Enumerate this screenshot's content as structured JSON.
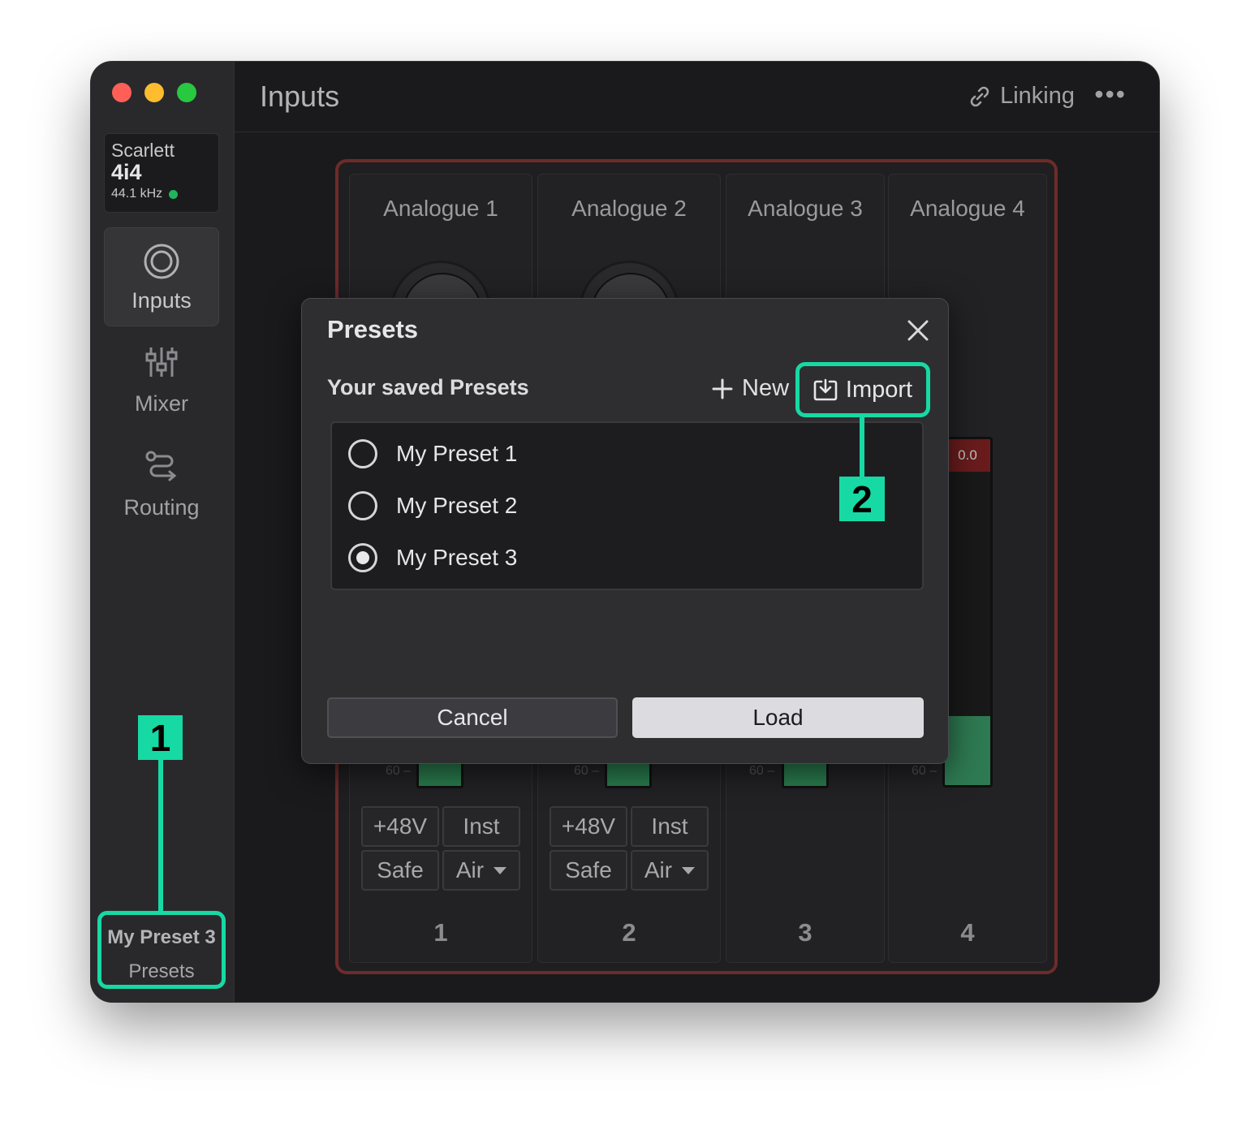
{
  "window": {
    "title": "Inputs"
  },
  "colors": {
    "accent": "#17d9a4",
    "traffic_red": "#ff5f57",
    "traffic_yellow": "#febc2e",
    "traffic_green": "#28c840",
    "status_led": "#22b35d"
  },
  "device": {
    "brand": "Scarlett",
    "model": "4i4",
    "sample_rate": "44.1 kHz"
  },
  "sidebar": {
    "items": [
      {
        "label": "Inputs",
        "icon": "inputs-icon",
        "active": true
      },
      {
        "label": "Mixer",
        "icon": "mixer-icon",
        "active": false
      },
      {
        "label": "Routing",
        "icon": "routing-icon",
        "active": false
      }
    ],
    "preset": {
      "name": "My Preset 3",
      "label": "Presets"
    }
  },
  "header": {
    "linking_label": "Linking",
    "more_label": "•••"
  },
  "channels": [
    {
      "title": "Analogue 1",
      "number": "1",
      "buttons": [
        "+48V",
        "Inst",
        "Safe",
        "Air"
      ],
      "scale_label": "60 –"
    },
    {
      "title": "Analogue 2",
      "number": "2",
      "buttons": [
        "+48V",
        "Inst",
        "Safe",
        "Air"
      ],
      "scale_label": "60 –"
    },
    {
      "title": "Analogue 3",
      "number": "3",
      "scale_label": "60 –"
    },
    {
      "title": "Analogue 4",
      "number": "4",
      "scale_label": "60 –",
      "clip_label": "0.0",
      "meter_level": 0.2
    }
  ],
  "dialog": {
    "title": "Presets",
    "subtitle": "Your saved Presets",
    "new_label": "New",
    "import_label": "Import",
    "presets": [
      {
        "name": "My Preset 1",
        "selected": false
      },
      {
        "name": "My Preset 2",
        "selected": false
      },
      {
        "name": "My Preset 3",
        "selected": true
      }
    ],
    "cancel_label": "Cancel",
    "load_label": "Load"
  },
  "callouts": {
    "one": "1",
    "two": "2"
  }
}
